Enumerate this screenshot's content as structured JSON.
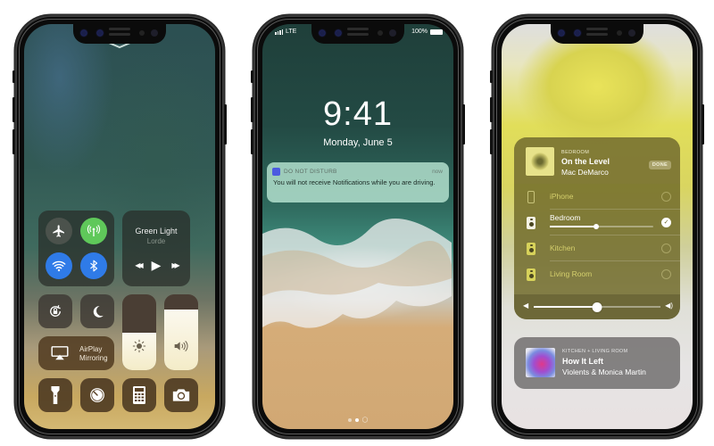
{
  "phones": [
    {
      "screen": "control-center",
      "connectivity": {
        "airplane_mode": {
          "icon": "airplane-icon",
          "on": false,
          "color": "#4b524c"
        },
        "cellular": {
          "icon": "cellular-antenna-icon",
          "on": true,
          "color": "#5fc85a"
        },
        "wifi": {
          "icon": "wifi-icon",
          "on": true,
          "color": "#2f7be8"
        },
        "bluetooth": {
          "icon": "bluetooth-icon",
          "on": true,
          "color": "#2f7be8"
        }
      },
      "music": {
        "title": "Green Light",
        "artist": "Lorde",
        "prev": "◀◀",
        "play": "▶",
        "next": "▶▶"
      },
      "rotation_lock": {
        "icon": "rotation-lock-icon"
      },
      "do_not_disturb": {
        "icon": "moon-icon",
        "glyph": "☾"
      },
      "brightness": {
        "icon": "sun-icon",
        "glyph": "☀",
        "level_percent": 50
      },
      "volume": {
        "icon": "speaker-icon",
        "glyph": "🔊",
        "level_percent": 80
      },
      "airplay_mirroring": {
        "line1": "AirPlay",
        "line2": "Mirroring"
      },
      "utilities": [
        {
          "name": "flashlight",
          "icon": "flashlight-icon"
        },
        {
          "name": "timer",
          "icon": "timer-icon"
        },
        {
          "name": "calculator",
          "icon": "calculator-icon"
        },
        {
          "name": "camera",
          "icon": "camera-icon"
        }
      ]
    },
    {
      "screen": "lock-screen",
      "status": {
        "carrier": "LTE",
        "battery": "100%"
      },
      "time": "9:41",
      "date": "Monday, June 5",
      "notification": {
        "app": "DO NOT DISTURB",
        "time": "now",
        "body": "You will not receive Notifications while you are driving.",
        "icon_color": "#4b5ae0"
      },
      "page_indicator": {
        "pages": 2,
        "current": 2,
        "has_camera": true
      }
    },
    {
      "screen": "airplay-audio",
      "now_playing": {
        "room": "BEDROOM",
        "title": "On the Level",
        "artist": "Mac DeMarco",
        "done_label": "DONE"
      },
      "devices": [
        {
          "name": "iPhone",
          "icon": "iphone-icon",
          "selected": false,
          "active": false
        },
        {
          "name": "Bedroom",
          "icon": "speaker-device-icon",
          "selected": true,
          "active": true,
          "volume_percent": 45
        },
        {
          "name": "Kitchen",
          "icon": "speaker-device-icon",
          "selected": false,
          "active": false
        },
        {
          "name": "Living Room",
          "icon": "speaker-device-icon",
          "selected": false,
          "active": false
        }
      ],
      "master_volume_percent": 50,
      "other_session": {
        "room": "KITCHEN + LIVING ROOM",
        "title": "How It Left",
        "artist": "Violents & Monica Martin"
      }
    }
  ]
}
